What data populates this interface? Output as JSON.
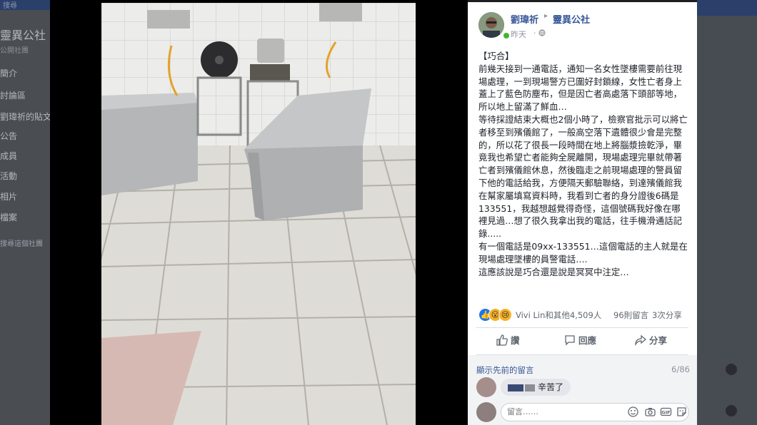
{
  "background_page": {
    "search_placeholder": "搜尋",
    "group_title": "靈異公社",
    "group_subtitle": "公開社團",
    "nav_items": [
      "簡介",
      "討論區",
      "劉瑋祈的貼文",
      "公告",
      "成員",
      "活動",
      "相片",
      "檔案"
    ],
    "bottom_link": "搜尋這個社團"
  },
  "photo": {
    "description_icon": "morgue-room-photo"
  },
  "post": {
    "author": "劉瑋祈",
    "group": "靈異公社",
    "time": "昨天",
    "privacy_icon": "globe-icon",
    "paragraphs": [
      "【巧合】",
      "前幾天接到一通電話，通知一名女性墜樓需要前往現場處理，一到現場警方已圍好封鎖線，女性亡者身上蓋上了藍色防塵布，但是因亡者高處落下頭部等地，所以地上留滿了鮮血…",
      "等待採證結束大概也2個小時了，檢察官批示可以將亡者移至到殯儀館了，一般高空落下遺體很少會是完整的，所以花了很長一段時間在地上將腦漿撿乾淨，畢竟我也希望亡者能夠全屍離開，現場處理完畢就帶著亡者到殯儀館休息，然後臨走之前現場處理的警員留下他的電話給我，方便隔天郵驗聯絡，到達殯儀館我在幫家屬填寫資料時，我看到亡者的身分證後6碼是133551，我越想越覺得奇怪，這個號碼我好像在哪裡見過…想了很久我拿出我的電話，往手機滑通話記錄.....",
      "有一個電話是09xx-133551…這個電話的主人就是在現場處理墜樓的員警電話….",
      "這應該說是巧合還是說是冥冥中注定…"
    ],
    "reactions_text": "Vivi Lin和其他4,509人",
    "comments_count": "96則留言",
    "shares_count": "3次分享",
    "actions": {
      "like": "讚",
      "comment": "回應",
      "share": "分享"
    },
    "comments": {
      "previous_link": "顯示先前的留言",
      "page_count": "6/86",
      "items": [
        {
          "text": "辛苦了"
        }
      ],
      "input_placeholder": "留言……"
    }
  },
  "colors": {
    "link": "#385898",
    "like_blue": "#1877f2",
    "emoji_yellow": "#f7b125",
    "comment_bg": "#f2f3f5"
  }
}
